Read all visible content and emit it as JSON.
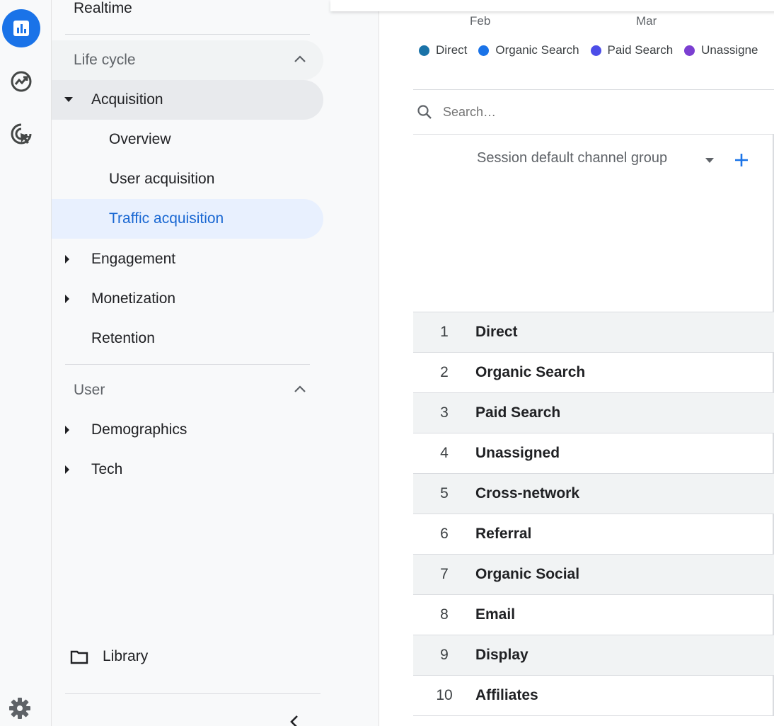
{
  "rail": {
    "items": [
      {
        "icon": "reports-bar-chart-icon",
        "active": true
      },
      {
        "icon": "explore-trend-icon",
        "active": false
      },
      {
        "icon": "advertising-target-icon",
        "active": false
      }
    ],
    "settings_icon": "gear-icon"
  },
  "nav": {
    "realtime": "Realtime",
    "lifecycle": {
      "header": "Life cycle",
      "acquisition": "Acquisition",
      "sub": [
        "Overview",
        "User acquisition",
        "Traffic acquisition"
      ],
      "engagement": "Engagement",
      "monetization": "Monetization",
      "retention": "Retention"
    },
    "user": {
      "header": "User",
      "demographics": "Demographics",
      "tech": "Tech"
    },
    "library": "Library"
  },
  "chart": {
    "x_labels": [
      "Feb",
      "Mar"
    ],
    "legend": [
      {
        "name": "Direct",
        "color": "#1a73a8"
      },
      {
        "name": "Organic Search",
        "color": "#1a73e8"
      },
      {
        "name": "Paid Search",
        "color": "#4c4de8"
      },
      {
        "name": "Unassigne",
        "color": "#7b3fd1"
      }
    ]
  },
  "table": {
    "search_placeholder": "Search…",
    "dimension_header": "Session default channel group",
    "rows": [
      {
        "rank": "1",
        "name": "Direct"
      },
      {
        "rank": "2",
        "name": "Organic Search"
      },
      {
        "rank": "3",
        "name": "Paid Search"
      },
      {
        "rank": "4",
        "name": "Unassigned"
      },
      {
        "rank": "5",
        "name": "Cross-network"
      },
      {
        "rank": "6",
        "name": "Referral"
      },
      {
        "rank": "7",
        "name": "Organic Social"
      },
      {
        "rank": "8",
        "name": "Email"
      },
      {
        "rank": "9",
        "name": "Display"
      },
      {
        "rank": "10",
        "name": "Affiliates"
      }
    ]
  },
  "colors": {
    "accent": "#1a73e8",
    "selected_bg": "#e8f0fe",
    "selected_text": "#1967d2",
    "expanded_bg": "#e8eaed"
  }
}
